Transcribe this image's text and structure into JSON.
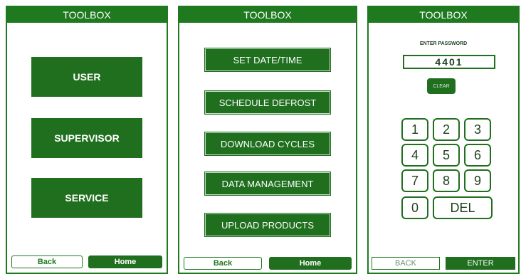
{
  "screens": [
    {
      "title": "TOOLBOX",
      "buttons": [
        "USER",
        "SUPERVISOR",
        "SERVICE"
      ],
      "back_label": "Back",
      "home_label": "Home"
    },
    {
      "title": "TOOLBOX",
      "buttons": [
        "SET DATE/TIME",
        "SCHEDULE DEFROST",
        "DOWNLOAD CYCLES",
        "DATA MANAGEMENT",
        "UPLOAD PRODUCTS"
      ],
      "back_label": "Back",
      "home_label": "Home"
    },
    {
      "title": "TOOLBOX",
      "password_label": "ENTER PASSWORD",
      "password_value": "4401",
      "clear_label": "CLEAR",
      "keys": [
        "1",
        "2",
        "3",
        "4",
        "5",
        "6",
        "7",
        "8",
        "9",
        "0",
        "DEL"
      ],
      "back_label": "BACK",
      "enter_label": "ENTER"
    }
  ],
  "colors": {
    "primary_green": "#1f6f1f",
    "border_green": "#1f7a1f",
    "background": "#ffffff"
  }
}
